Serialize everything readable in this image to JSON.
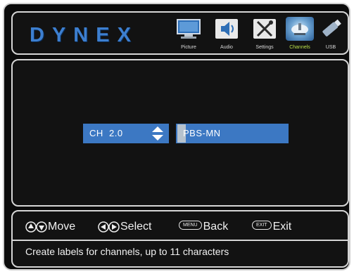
{
  "brand": "DYNEX",
  "menu": [
    {
      "label": "Picture",
      "icon": "tv-monitor-icon",
      "active": false
    },
    {
      "label": "Audio",
      "icon": "speaker-icon",
      "active": false
    },
    {
      "label": "Settings",
      "icon": "tools-icon",
      "active": false
    },
    {
      "label": "Channels",
      "icon": "satellite-dish-icon",
      "active": true
    },
    {
      "label": "USB",
      "icon": "usb-drive-icon",
      "active": false
    }
  ],
  "channel_select": {
    "value": "CH  2.0"
  },
  "channel_label_input": {
    "value": "PBS-MN"
  },
  "hints": {
    "move": "Move",
    "select": "Select",
    "menu_key": "MENU",
    "back": "Back",
    "exit_key": "EXIT",
    "exit": "Exit"
  },
  "status": "Create labels for channels, up to 11 characters",
  "colors": {
    "brand_blue": "#3d7fd0",
    "field_blue": "#3c78c3",
    "active_label": "#b9e04a",
    "background": "#0b0b0b"
  }
}
